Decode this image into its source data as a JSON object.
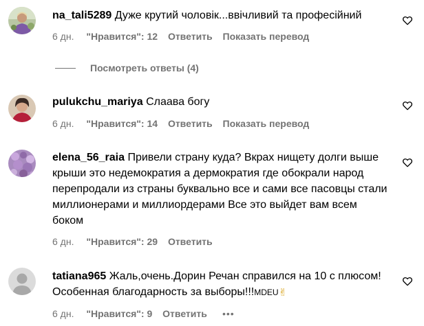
{
  "comments": [
    {
      "username": "na_tali5289",
      "text": "Дуже крутий чоловік...ввічливий та професійний",
      "age": "6 дн.",
      "likes": "\"Нравится\": 12",
      "reply_label": "Ответить",
      "translate_label": "Показать перевод",
      "view_replies": "Посмотреть ответы (4)"
    },
    {
      "username": "pulukchu_mariya",
      "text": "Слаава богу",
      "age": "6 дн.",
      "likes": "\"Нравится\": 14",
      "reply_label": "Ответить",
      "translate_label": "Показать перевод"
    },
    {
      "username": "elena_56_raia",
      "text": "Привели страну куда? Вкрах нищету долги выше крыши это недемократия а дермократия где обокрали народ перепродали из страны буквально все и сами все пасовцы стали миллионерами и миллиордерами Все это выйдет вам всем боком",
      "age": "6 дн.",
      "likes": "\"Нравится\": 29",
      "reply_label": "Ответить"
    },
    {
      "username": "tatiana965",
      "text": "Жаль,очень.Дорин Речан справился на 10 с плюсом!Особенная благодарность за выборы!!!",
      "text_suffix": "MDEU",
      "emoji": "✌",
      "age": "6 дн.",
      "likes": "\"Нравится\": 9",
      "reply_label": "Ответить",
      "more_label": "•••"
    }
  ],
  "icons": {
    "heart": "heart-outline-icon",
    "avatar_default": "default-avatar-icon"
  },
  "colors": {
    "secondary_text": "#737373",
    "primary_text": "#000000",
    "avatar_placeholder": "#c7c7c7",
    "emoji_yellow": "#f7c948"
  }
}
